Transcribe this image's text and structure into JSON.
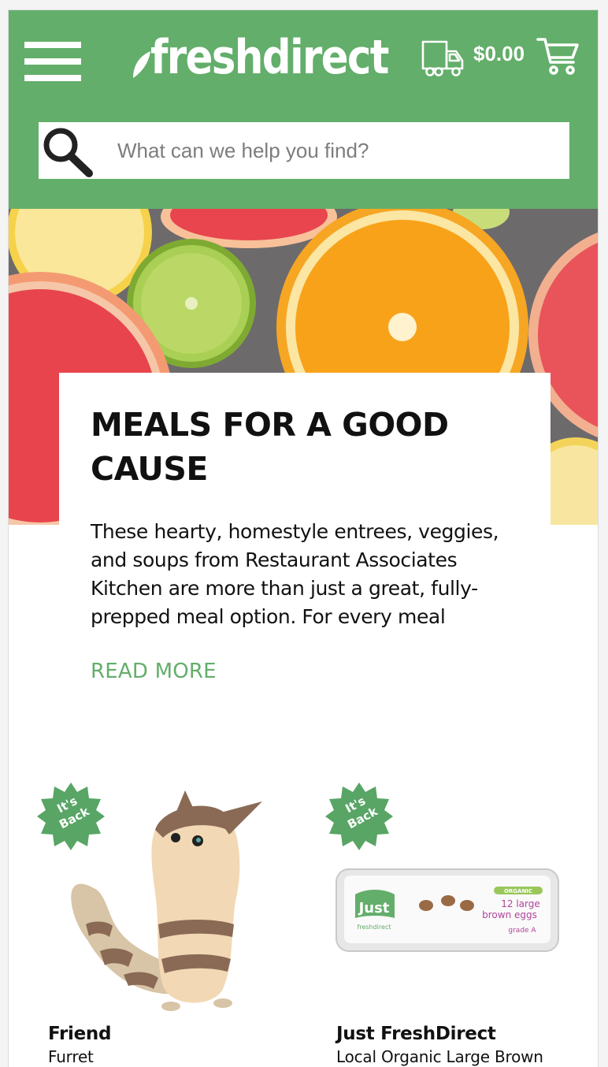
{
  "header": {
    "logo_text": "freshdirect",
    "cart_total": "$0.00"
  },
  "search": {
    "placeholder": "What can we help you find?"
  },
  "feature": {
    "title": "MEALS FOR A GOOD CAUSE",
    "body": "These hearty, homestyle entrees, veggies, and soups from Restaurant Associates Kitchen are more than just a great, fully- prepped meal option. For every meal",
    "cta": "READ MORE"
  },
  "products": [
    {
      "badge_line1": "It's",
      "badge_line2": "Back",
      "brand": "Friend",
      "name": "Furret"
    },
    {
      "badge_line1": "It's",
      "badge_line2": "Back",
      "brand": "Just FreshDirect",
      "name": "Local Organic Large Brown",
      "package": {
        "brand_word": "Just",
        "sub": "freshdirect",
        "tag": "ORGANIC",
        "line1": "12 large",
        "line2": "brown eggs",
        "grade": "grade A"
      }
    }
  ],
  "colors": {
    "brand_green": "#63ae6a",
    "text": "#111111"
  }
}
